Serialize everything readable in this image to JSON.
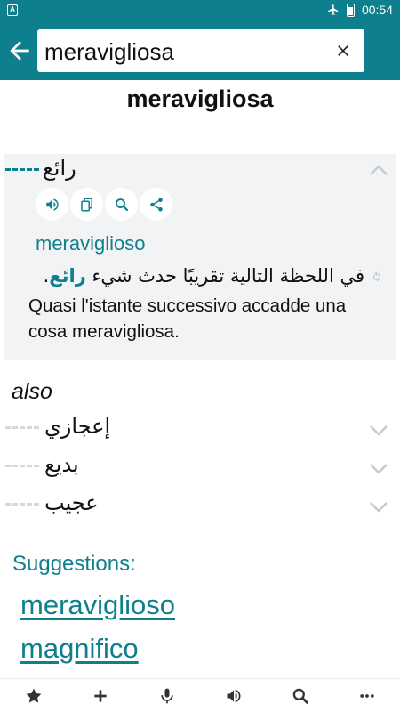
{
  "status_bar": {
    "app_icon": "A",
    "time": "00:54",
    "icons": [
      "airplane-icon",
      "battery-icon"
    ]
  },
  "search": {
    "value": "meraviglioso",
    "query": "meravigliosa"
  },
  "colors": {
    "accent": "#0e7f8c",
    "entry_bg": "#f1f3f5",
    "rank_inactive": "#d3d8dc"
  },
  "headword": "meravigliosa",
  "main_entry": {
    "word": "رائع",
    "actions": [
      "speaker-icon",
      "copy-icon",
      "search-icon",
      "share-icon"
    ],
    "back_translation": "meraviglioso",
    "example_ar_before": "في اللحظة التالية تقريبًا حدث شيء ",
    "example_ar_highlight": "رائع",
    "example_ar_after": ".",
    "example_it": "Quasi l'istante successivo accadde una cosa meravigliosa."
  },
  "also_label": "also",
  "alternatives": [
    {
      "word": "إعجازي"
    },
    {
      "word": "بديع"
    },
    {
      "word": "عجيب"
    }
  ],
  "suggestions": {
    "label": "Suggestions:",
    "items": [
      "meraviglioso",
      "magnifico"
    ]
  },
  "bottom_nav": [
    "star-icon",
    "plus-icon",
    "microphone-icon",
    "speaker-icon",
    "search-icon",
    "more-icon"
  ]
}
